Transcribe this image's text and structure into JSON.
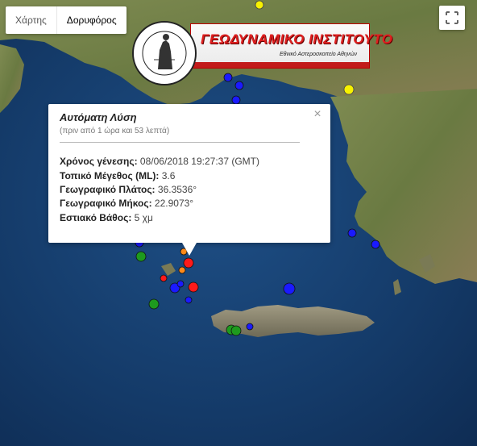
{
  "map": {
    "type_controls": [
      {
        "label": "Χάρτης",
        "active": false
      },
      {
        "label": "Δορυφόρος",
        "active": true
      }
    ],
    "fullscreen_icon": "fullscreen-icon",
    "colors": {
      "sea": "#173a66",
      "land": "#6d7a45",
      "marker_blue": "#1a1aff",
      "marker_red": "#ff1a1a",
      "marker_orange": "#ff8a1a",
      "marker_green": "#1e9a1e",
      "marker_yellow": "#f7f200"
    }
  },
  "logo": {
    "title": "ΓΕΩΔΥΝΑΜΙΚΟ ΙΝΣΤΙΤΟΥΤΟ",
    "subtitle": "Εθνικό Αστεροσκοπείο Αθηνών",
    "seal_top": "ΕΘΝΙΚΟΝ ΑΣΤΕΡΟΣΚΟΠΕΙΟΝ ΑΘΗΝΩΝ",
    "seal_bottom": "NATIONAL OBSERVATORY OF ATHENS"
  },
  "info": {
    "title": "Αυτόματη Λύση",
    "ago": "(πριν από 1 ώρα και 53 λεπτά)",
    "rows": [
      {
        "label": "Χρόνος γένεσης:",
        "value": " 08/06/2018  19:27:37 (GMT)"
      },
      {
        "label": "Τοπικό Μέγεθος (ML):",
        "value": " 3.6"
      },
      {
        "label": "Γεωγραφικό Πλάτος:",
        "value": " 36.3536°"
      },
      {
        "label": "Γεωγραφικό Μήκος:",
        "value": " 22.9073°"
      },
      {
        "label": "Εστιακό Βάθος:",
        "value": " 5 χμ"
      }
    ],
    "close": "×"
  }
}
